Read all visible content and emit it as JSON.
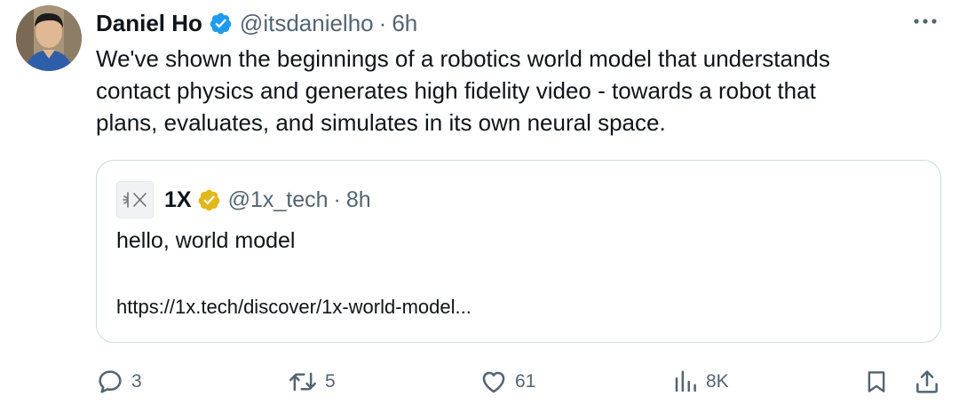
{
  "tweet": {
    "author_name": "Daniel Ho",
    "author_handle": "@itsdanielho",
    "separator": "·",
    "time": "6h",
    "more_icon": "more-horizontal-icon",
    "body_lines": [
      "We've shown the beginnings of a robotics world model that understands",
      "contact physics and generates high fidelity video - towards a robot that",
      "plans, evaluates, and simulates in its own neural space."
    ]
  },
  "quote": {
    "logo_text": "⏆✕",
    "author_name": "1X",
    "author_handle": "@1x_tech",
    "separator": "·",
    "time": "8h",
    "text": "hello, world model",
    "link": "https://1x.tech/discover/1x-world-model..."
  },
  "actions": {
    "replies": "3",
    "reposts": "5",
    "likes": "61",
    "views": "8K"
  },
  "colors": {
    "verified_blue": "#1d9bf0",
    "verified_gold": "#e2b719",
    "secondary_text": "#536471",
    "border": "#cfd9de"
  }
}
